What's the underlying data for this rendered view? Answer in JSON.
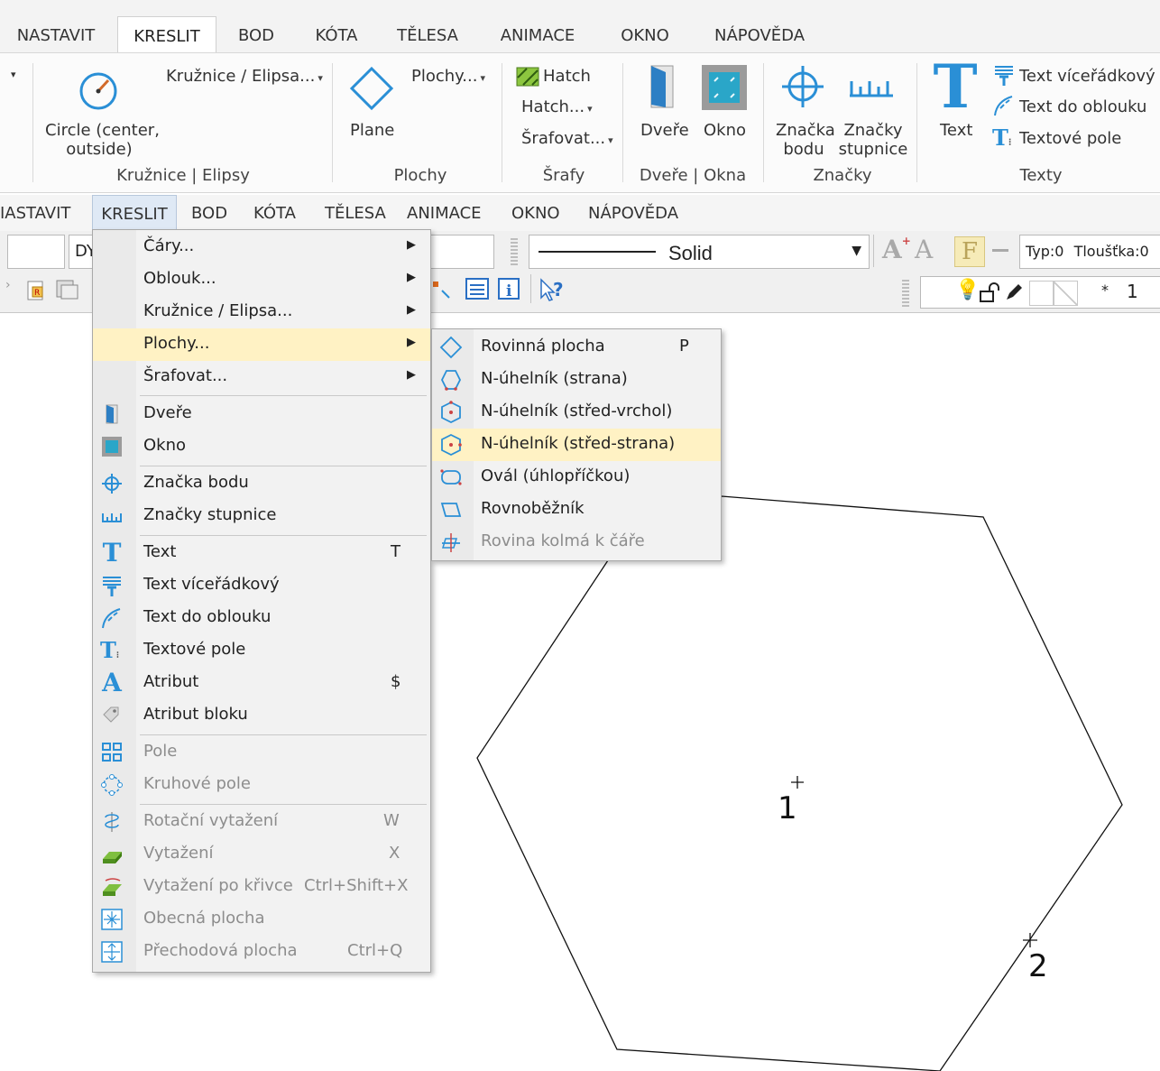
{
  "ribbon": {
    "tabs": [
      "NASTAVIT",
      "KRESLIT",
      "BOD",
      "KÓTA",
      "TĚLESA",
      "ANIMACE",
      "OKNO",
      "NÁPOVĚDA"
    ],
    "circle_label": "Circle (center, outside)",
    "circle_label_l1": "Circle (center,",
    "circle_label_l2": "outside)",
    "circles_dropdown": "Kružnice / Elipsa...",
    "group_circles": "Kružnice | Elipsy",
    "plane_label": "Plane",
    "surfaces_dropdown": "Plochy...",
    "group_surfaces": "Plochy",
    "hatch_label": "Hatch",
    "hatch_dropdown": "Hatch...",
    "hatching_dropdown": "Šrafovat...",
    "group_hatches": "Šrafy",
    "door_label": "Dveře",
    "window_label": "Okno",
    "group_doors": "Dveře | Okna",
    "pointmark_l1": "Značka",
    "pointmark_l2": "bodu",
    "scalemarks_l1": "Značky",
    "scalemarks_l2": "stupnice",
    "group_marks": "Značky",
    "text_label": "Text",
    "text_multi": "Text víceřádkový",
    "text_arc": "Text do oblouku",
    "text_field": "Textové pole",
    "group_texts": "Texty"
  },
  "menubar": {
    "items": [
      "NASTAVIT",
      "KRESLIT",
      "BOD",
      "KÓTA",
      "TĚLESA",
      "ANIMACE",
      "OKNO",
      "NÁPOVĚDA"
    ],
    "first_partial": "IASTAVIT"
  },
  "toolbar": {
    "field_partial": "DY",
    "linetype": "Solid",
    "type_label": "Typ:0",
    "thickness_label": "Tloušťka:0",
    "layer_star": "*",
    "layer_num": "1"
  },
  "kreslit_menu": {
    "items": [
      {
        "label": "Čáry...",
        "shortcut": "",
        "submenu": true,
        "icon": "none",
        "disabled": false
      },
      {
        "label": "Oblouk...",
        "shortcut": "",
        "submenu": true,
        "icon": "none",
        "disabled": false
      },
      {
        "label": "Kružnice / Elipsa...",
        "shortcut": "",
        "submenu": true,
        "icon": "none",
        "disabled": false
      },
      {
        "label": "Plochy...",
        "shortcut": "",
        "submenu": true,
        "icon": "none",
        "disabled": false
      },
      {
        "label": "Šrafovat...",
        "shortcut": "",
        "submenu": true,
        "icon": "none",
        "disabled": false
      },
      {
        "label": "Dveře",
        "shortcut": "",
        "submenu": false,
        "icon": "door-icon",
        "disabled": false
      },
      {
        "label": "Okno",
        "shortcut": "",
        "submenu": false,
        "icon": "window-icon",
        "disabled": false
      },
      {
        "label": "Značka bodu",
        "shortcut": "",
        "submenu": false,
        "icon": "point-mark-icon",
        "disabled": false
      },
      {
        "label": "Značky stupnice",
        "shortcut": "",
        "submenu": false,
        "icon": "scale-marks-icon",
        "disabled": false
      },
      {
        "label": "Text",
        "shortcut": "T",
        "submenu": false,
        "icon": "text-icon",
        "disabled": false
      },
      {
        "label": "Text víceřádkový",
        "shortcut": "",
        "submenu": false,
        "icon": "multiline-text-icon",
        "disabled": false
      },
      {
        "label": "Text do oblouku",
        "shortcut": "",
        "submenu": false,
        "icon": "arc-text-icon",
        "disabled": false
      },
      {
        "label": "Textové pole",
        "shortcut": "",
        "submenu": false,
        "icon": "text-field-icon",
        "disabled": false
      },
      {
        "label": "Atribut",
        "shortcut": "$",
        "submenu": false,
        "icon": "attribute-icon",
        "disabled": false
      },
      {
        "label": "Atribut bloku",
        "shortcut": "",
        "submenu": false,
        "icon": "block-attribute-icon",
        "disabled": false
      },
      {
        "label": "Pole",
        "shortcut": "",
        "submenu": false,
        "icon": "array-icon",
        "disabled": true
      },
      {
        "label": "Kruhové pole",
        "shortcut": "",
        "submenu": false,
        "icon": "circular-array-icon",
        "disabled": true
      },
      {
        "label": "Rotační vytažení",
        "shortcut": "W",
        "submenu": false,
        "icon": "revolve-icon",
        "disabled": true
      },
      {
        "label": "Vytažení",
        "shortcut": "X",
        "submenu": false,
        "icon": "extrude-icon",
        "disabled": true
      },
      {
        "label": "Vytažení po křivce",
        "shortcut": "Ctrl+Shift+X",
        "submenu": false,
        "icon": "sweep-icon",
        "disabled": true
      },
      {
        "label": "Obecná plocha",
        "shortcut": "",
        "submenu": false,
        "icon": "general-surface-icon",
        "disabled": true
      },
      {
        "label": "Přechodová plocha",
        "shortcut": "Ctrl+Q",
        "submenu": false,
        "icon": "loft-surface-icon",
        "disabled": true
      }
    ]
  },
  "plochy_submenu": {
    "items": [
      {
        "label": "Rovinná plocha",
        "shortcut": "P",
        "icon": "plane-surface-icon",
        "disabled": false
      },
      {
        "label": "N-úhelník (strana)",
        "shortcut": "",
        "icon": "polygon-side-icon",
        "disabled": false
      },
      {
        "label": "N-úhelník (střed-vrchol)",
        "shortcut": "",
        "icon": "polygon-center-vertex-icon",
        "disabled": false
      },
      {
        "label": "N-úhelník (střed-strana)",
        "shortcut": "",
        "icon": "polygon-center-side-icon",
        "disabled": false
      },
      {
        "label": "Ovál (úhlopříčkou)",
        "shortcut": "",
        "icon": "oval-icon",
        "disabled": false
      },
      {
        "label": "Rovnoběžník",
        "shortcut": "",
        "icon": "parallelogram-icon",
        "disabled": false
      },
      {
        "label": "Rovina kolmá k čáře",
        "shortcut": "",
        "icon": "perpendicular-plane-icon",
        "disabled": true
      }
    ]
  },
  "canvas": {
    "point1_label": "1",
    "point2_label": "2"
  }
}
